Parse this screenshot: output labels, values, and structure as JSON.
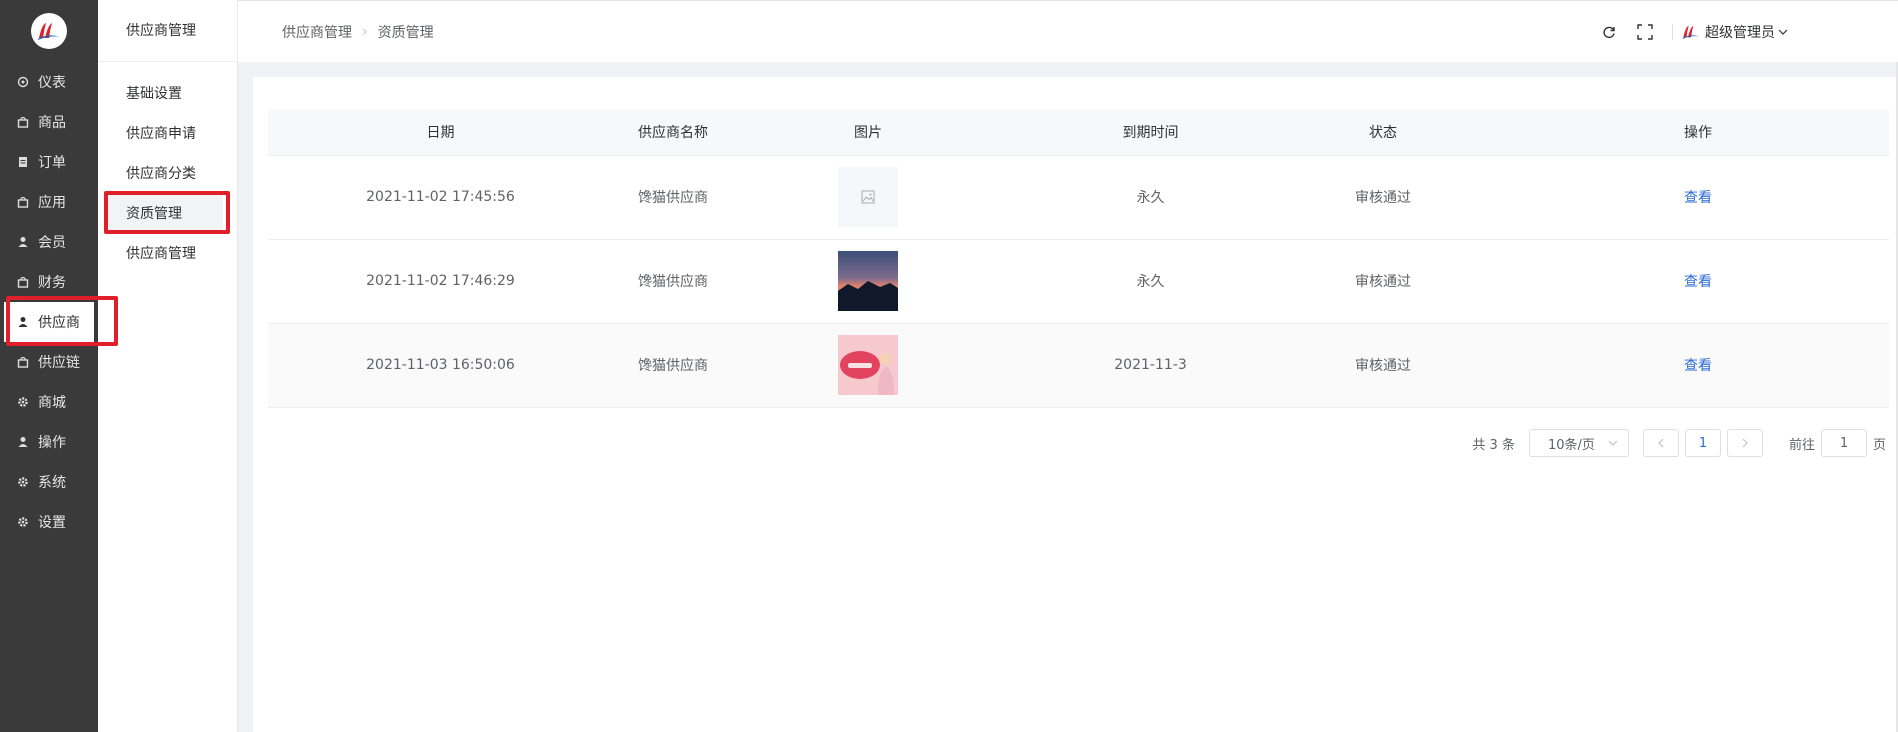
{
  "sidebar": {
    "items": [
      {
        "label": "仪表",
        "icon": "dashboard-icon",
        "active": false
      },
      {
        "label": "商品",
        "icon": "bag-icon",
        "active": false
      },
      {
        "label": "订单",
        "icon": "order-icon",
        "active": false
      },
      {
        "label": "应用",
        "icon": "bag-icon",
        "active": false
      },
      {
        "label": "会员",
        "icon": "user-icon",
        "active": false
      },
      {
        "label": "财务",
        "icon": "bag-icon",
        "active": false
      },
      {
        "label": "供应商",
        "icon": "user-icon",
        "active": true
      },
      {
        "label": "供应链",
        "icon": "bag-icon",
        "active": false
      },
      {
        "label": "商城",
        "icon": "gear-icon",
        "active": false
      },
      {
        "label": "操作",
        "icon": "user-icon",
        "active": false
      },
      {
        "label": "系统",
        "icon": "gear-icon",
        "active": false
      },
      {
        "label": "设置",
        "icon": "gear-icon",
        "active": false
      }
    ]
  },
  "submenu": {
    "title": "供应商管理",
    "items": [
      {
        "label": "基础设置",
        "active": false
      },
      {
        "label": "供应商申请",
        "active": false
      },
      {
        "label": "供应商分类",
        "active": false
      },
      {
        "label": "资质管理",
        "active": true
      },
      {
        "label": "供应商管理",
        "active": false
      }
    ]
  },
  "header": {
    "breadcrumb": [
      "供应商管理",
      "资质管理"
    ],
    "user_name": "超级管理员"
  },
  "table": {
    "columns": [
      "日期",
      "供应商名称",
      "图片",
      "到期时间",
      "状态",
      "操作"
    ],
    "rows": [
      {
        "date": "2021-11-02 17:45:56",
        "name": "馋猫供应商",
        "image": "placeholder",
        "expire": "永久",
        "status": "审核通过",
        "action": "查看"
      },
      {
        "date": "2021-11-02 17:46:29",
        "name": "馋猫供应商",
        "image": "sunset-photo",
        "expire": "永久",
        "status": "审核通过",
        "action": "查看"
      },
      {
        "date": "2021-11-03 16:50:06",
        "name": "馋猫供应商",
        "image": "pink-promo",
        "expire": "2021-11-3",
        "status": "审核通过",
        "action": "查看"
      }
    ]
  },
  "pagination": {
    "total": "共 3 条",
    "page_size": "10条/页",
    "current_page": "1",
    "goto_label": "前往",
    "goto_value": "1",
    "page_suffix": "页"
  },
  "colors": {
    "sidebar_bg": "#3a3a3a",
    "link": "#2d6bd6",
    "highlight": "#e01f2a"
  }
}
